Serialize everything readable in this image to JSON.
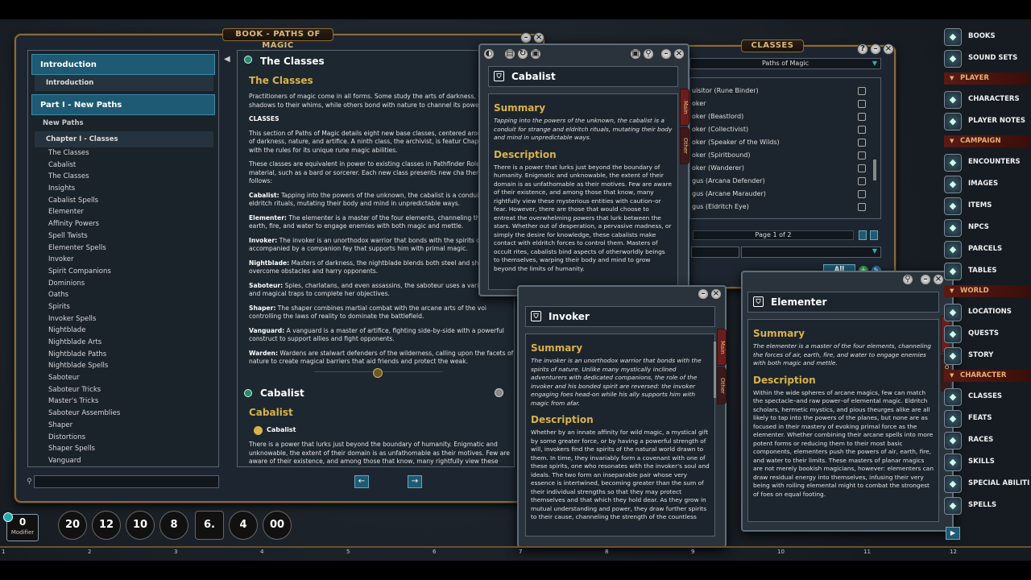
{
  "book_window": {
    "title": "BOOK - PATHS OF MAGIC",
    "search_placeholder": ""
  },
  "toc": {
    "section_intro": "Introduction",
    "intro_sub": "Introduction",
    "part_header": "Part I - New Paths",
    "new_paths": "New Paths",
    "chapter": "Chapter I - Classes",
    "items": [
      "The Classes",
      "Cabalist",
      "The Classes",
      "Insights",
      "Cabalist Spells",
      "Elementer",
      "Affinity Powers",
      "Spell Twists",
      "Elementer Spells",
      "Invoker",
      "Spirit Companions",
      "Dominions",
      "Oaths",
      "Spirits",
      "Invoker Spells",
      "Nightblade",
      "Nightblade Arts",
      "Nightblade Paths",
      "Nightblade Spells",
      "Saboteur",
      "Saboteur Tricks",
      "Master's Tricks",
      "Saboteur Assemblies",
      "Shaper",
      "Distortions",
      "Shaper Spells",
      "Vanguard"
    ]
  },
  "book": {
    "section1_title": "The Classes",
    "section1_heading": "The Classes",
    "p1": "Practitioners of magic come in all forms. Some study the arts of darkness, mo shadows to their whims, while others bond with nature to channel its power.",
    "classes_label": "CLASSES",
    "p2": "This section of Paths of Magic details eight new base classes, centered aroun themes of darkness, nature, and artifice. A ninth class, the archivist, is featur Chapter VI along with the rules for its unique rune magic abilities.",
    "p3": "These classes are equivalent in power to existing classes in Pathfinder Rolepl Game material, such as a bard or sorcerer. Each new class presents new cha themes, as follows:",
    "entries": [
      {
        "name": "Cabalist:",
        "text": " Tapping into the powers of the unknown, the cabalist is a conduit fo and eldritch rituals, mutating their body and mind in unpredictable ways."
      },
      {
        "name": "Elementer:",
        "text": " The elementer is a master of the four elements, channeling the f air, earth, fire, and water to engage enemies with both magic and mettle."
      },
      {
        "name": "Invoker:",
        "text": " The invoker is an unorthodox warrior that bonds with the spirits of accompanied by a companion fey that supports him with primal magic."
      },
      {
        "name": "Nightblade:",
        "text": " Masters of darkness, the nightblade blends both steel and shad overcome obstacles and harry opponents."
      },
      {
        "name": "Saboteur:",
        "text": " Spies, charlatans, and even assassins, the saboteur uses a variety tricks and magical traps to complete her objectives."
      },
      {
        "name": "Shaper:",
        "text": " The shaper combines martial combat with the arcane arts of the voi controlling the laws of reality to dominate the battlefield."
      },
      {
        "name": "Vanguard:",
        "text": " A vanguard is a master of artifice, fighting side-by-side with a powerful construct to support allies and fight opponents."
      },
      {
        "name": "Warden:",
        "text": " Wardens are stalwart defenders of the wilderness, calling upon the facets of nature to create magical barriers that aid friends and protect the weak."
      }
    ],
    "section2_title": "Cabalist",
    "section2_heading": "Cabalist",
    "section2_link": "Cabalist",
    "p4": "There is a power that lurks just beyond the boundary of humanity. Enigmatic and unknowable, the extent of their domain is as unfathomable as their motives. Few are aware of their existence, and among those that know, many rightfully view these"
  },
  "cabalist": {
    "title": "Cabalist",
    "summary_label": "Summary",
    "summary": "Tapping into the powers of the unknown, the cabalist is a conduit for strange and eldritch rituals, mutating their body and mind in unpredictable ways.",
    "description_label": "Description",
    "description": "There is a power that lurks just beyond the boundary of humanity. Enigmatic and unknowable, the extent of their domain is as unfathomable as their motives. Few are aware of their existence, and among those that know, many rightfully view these mysterious entities with caution–or fear. However, there are those that would choose to entreat the overwhelming powers that lurk between the stars. Whether out of desperation, a pervasive madness, or simply the desire for knowledge, these cabalists make contact with eldritch forces to control them. Masters of occult rites, cabalists bind aspects of otherworldly beings to themselves, warping their body and mind to grow beyond the limits of humanity.",
    "tab_main": "Main",
    "tab_other": "Other"
  },
  "invoker": {
    "title": "Invoker",
    "summary_label": "Summary",
    "summary": "The invoker is an unorthodox warrior that bonds with the spirits of nature. Unlike many mystically inclined adventurers with dedicated companions, the role of the invoker and his bonded spirit are reversed: the invoker engaging foes head-on while his ally supports him with magic from afar.",
    "description_label": "Description",
    "description": "Whether by an innate affinity for wild magic, a mystical gift by some greater force, or by having a powerful strength of will, invokers find the spirits of the natural world drawn to them. In time, they invariably form a covenant with one of these spirits, one who resonates with the invoker's soul and ideals. The two form an inseparable pair whose very essence is intertwined, becoming greater than the sum of their individual strengths so that they may protect themselves and that which they hold dear. As they grow in mutual understanding and power, they draw further spirits to their cause, channeling the strength of the countless",
    "tab_main": "Main",
    "tab_other": "Other"
  },
  "elementer": {
    "title": "Elementer",
    "summary_label": "Summary",
    "summary": "The elementer is a master of the four elements, channeling the forces of air, earth, fire, and water to engage enemies with both magic and mettle.",
    "description_label": "Description",
    "description": "Within the wide spheres of arcane magics, few can match the spectacle–and raw power–of elemental magic. Eldritch scholars, hermetic mystics, and pious theurges alike are all likely to tap into the powers of the planes, but none are as focused in their mastery of evoking primal force as the elementer. Whether combining their arcane spells into more potent forms or reducing them to their most basic components, elementers push the powers of air, earth, fire, and water to their limits. These masters of planar magics are not merely bookish magicians, however: elementers can draw residual energy into themselves, infusing their very being with roiling elemental might to combat the strongest of foes on equal footing.",
    "tab_main": "Main",
    "tab_other": "Other"
  },
  "classes_window": {
    "title": "CLASSES",
    "filter": "Paths of Magic",
    "rows": [
      "uisitor (Rune Binder)",
      "oker",
      "oker (Beastlord)",
      "oker (Collectivist)",
      "oker (Speaker of the Wilds)",
      "oker (Spiritbound)",
      "oker (Wanderer)",
      "gus (Arcana Defender)",
      "gus (Arcane Marauder)",
      "gus (Eldritch Eye)"
    ],
    "page_label": "Page 1 of 2",
    "all_button": "All"
  },
  "sidebar": {
    "top_items": [
      {
        "label": "BOOKS",
        "icon": "book-icon"
      },
      {
        "label": "SOUND SETS",
        "icon": "music-icon"
      }
    ],
    "player_label": "PLAYER",
    "player_items": [
      {
        "label": "CHARACTERS",
        "icon": "person-icon"
      },
      {
        "label": "PLAYER NOTES",
        "icon": "notes-icon"
      }
    ],
    "campaign_label": "CAMPAIGN",
    "campaign_items": [
      {
        "label": "ENCOUNTERS",
        "icon": "swords-icon"
      },
      {
        "label": "IMAGES",
        "icon": "image-icon"
      },
      {
        "label": "ITEMS",
        "icon": "bag-icon"
      },
      {
        "label": "NPCS",
        "icon": "npc-icon"
      },
      {
        "label": "PARCELS",
        "icon": "parcel-icon"
      },
      {
        "label": "TABLES",
        "icon": "table-icon"
      }
    ],
    "world_label": "WORLD",
    "world_items": [
      {
        "label": "LOCATIONS",
        "icon": "location-icon"
      },
      {
        "label": "QUESTS",
        "icon": "quest-icon"
      },
      {
        "label": "STORY",
        "icon": "story-icon"
      }
    ],
    "character_label": "CHARACTER",
    "character_items": [
      {
        "label": "CLASSES",
        "icon": "class-icon"
      },
      {
        "label": "FEATS",
        "icon": "feat-icon"
      },
      {
        "label": "RACES",
        "icon": "race-icon"
      },
      {
        "label": "SKILLS",
        "icon": "skill-icon"
      },
      {
        "label": "SPECIAL ABILITI",
        "icon": "ability-icon"
      },
      {
        "label": "SPELLS",
        "icon": "spell-icon"
      }
    ]
  },
  "modifier": {
    "value": "0",
    "label": "Modifier"
  },
  "dice": [
    "20",
    "12",
    "10",
    "8",
    "6.",
    "4",
    "00"
  ],
  "ruler": [
    "1",
    "2",
    "3",
    "4",
    "5",
    "6",
    "7",
    "8",
    "9",
    "10",
    "11",
    "12"
  ]
}
